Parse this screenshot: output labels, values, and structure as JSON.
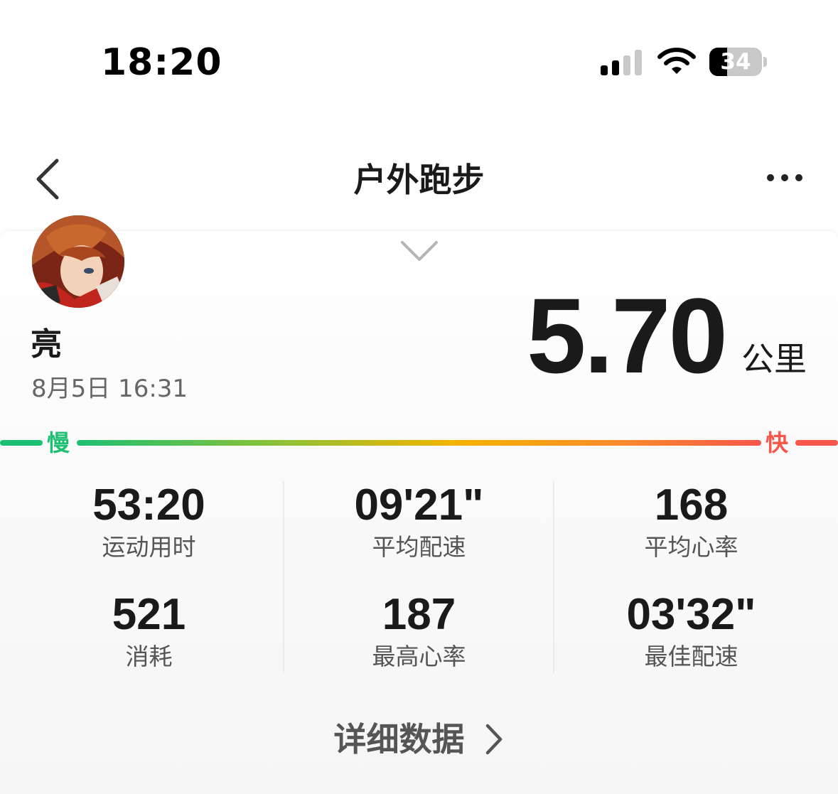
{
  "status_bar": {
    "time": "18:20",
    "battery_level": "34",
    "battery_fraction": 0.34,
    "signal_bars": 2,
    "signal_bars_total": 4
  },
  "nav": {
    "title": "户外跑步",
    "back_icon": "chevron-left-icon",
    "more_icon": "ellipsis-icon"
  },
  "profile": {
    "name": "亮",
    "date": "8月5日 16:31"
  },
  "distance": {
    "value": "5.70",
    "unit": "公里"
  },
  "pace_scale": {
    "slow_label": "慢",
    "fast_label": "快",
    "slow_color": "#1dbf73",
    "fast_color": "#f7564a"
  },
  "stats": [
    {
      "value": "53:20",
      "label": "运动用时"
    },
    {
      "value": "09'21\"",
      "label": "平均配速"
    },
    {
      "value": "168",
      "label": "平均心率"
    },
    {
      "value": "521",
      "label": "消耗"
    },
    {
      "value": "187",
      "label": "最高心率"
    },
    {
      "value": "03'32\"",
      "label": "最佳配速"
    }
  ],
  "detail": {
    "label": "详细数据"
  }
}
